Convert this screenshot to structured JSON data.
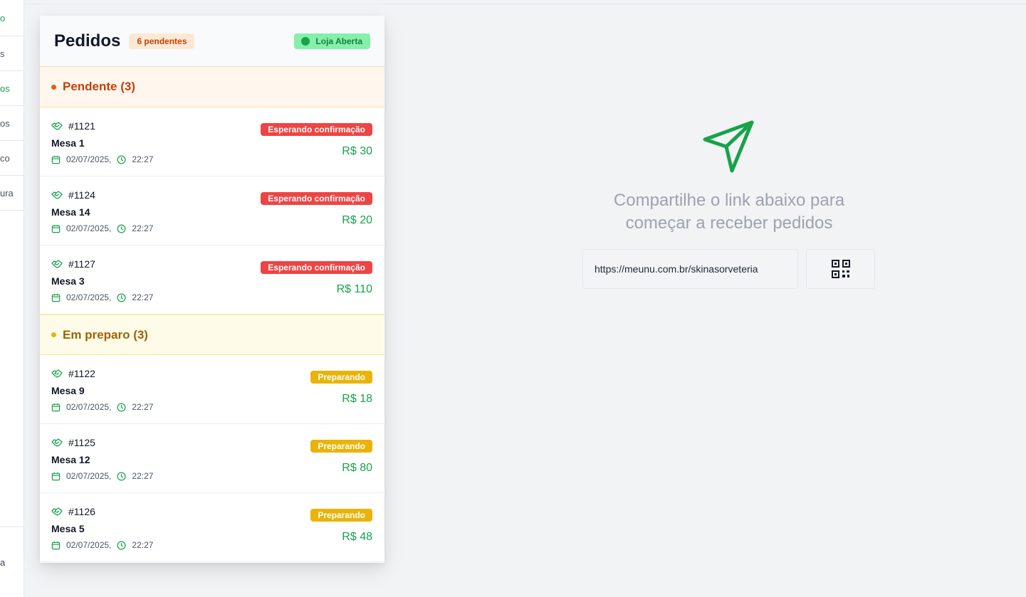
{
  "sidebar": {
    "items": [
      {
        "label": "o",
        "active": true
      },
      {
        "label": "s",
        "active": false
      },
      {
        "label": "os",
        "active": true
      },
      {
        "label": "os",
        "active": false
      },
      {
        "label": "co",
        "active": false
      },
      {
        "label": "ura",
        "active": false
      }
    ],
    "bottom_label": "a"
  },
  "panel": {
    "title": "Pedidos",
    "pending_badge": "6 pendentes",
    "store_status": "Loja Aberta"
  },
  "groups": [
    {
      "title": "Pendente (3)",
      "orders": [
        {
          "id": "#1121",
          "table": "Mesa 1",
          "date": "02/07/2025,",
          "time": "22:27",
          "status": "Esperando confirmação",
          "price": "R$ 30"
        },
        {
          "id": "#1124",
          "table": "Mesa 14",
          "date": "02/07/2025,",
          "time": "22:27",
          "status": "Esperando confirmação",
          "price": "R$ 20"
        },
        {
          "id": "#1127",
          "table": "Mesa 3",
          "date": "02/07/2025,",
          "time": "22:27",
          "status": "Esperando confirmação",
          "price": "R$ 110"
        }
      ]
    },
    {
      "title": "Em preparo (3)",
      "orders": [
        {
          "id": "#1122",
          "table": "Mesa 9",
          "date": "02/07/2025,",
          "time": "22:27",
          "status": "Preparando",
          "price": "R$ 18"
        },
        {
          "id": "#1125",
          "table": "Mesa 12",
          "date": "02/07/2025,",
          "time": "22:27",
          "status": "Preparando",
          "price": "R$ 80"
        },
        {
          "id": "#1126",
          "table": "Mesa 5",
          "date": "02/07/2025,",
          "time": "22:27",
          "status": "Preparando",
          "price": "R$ 48"
        }
      ]
    }
  ],
  "share": {
    "text_line1": "Compartilhe o link abaixo para",
    "text_line2": "começar a receber pedidos",
    "link": "https://meunu.com.br/skinasorveteria",
    "icon": "send-icon",
    "qr_icon": "qr-code-icon"
  },
  "colors": {
    "accent": "#16a34a",
    "pending": "#c2410c",
    "preparing": "#a16207",
    "status_red": "#ef4444",
    "status_yellow": "#eab308"
  }
}
